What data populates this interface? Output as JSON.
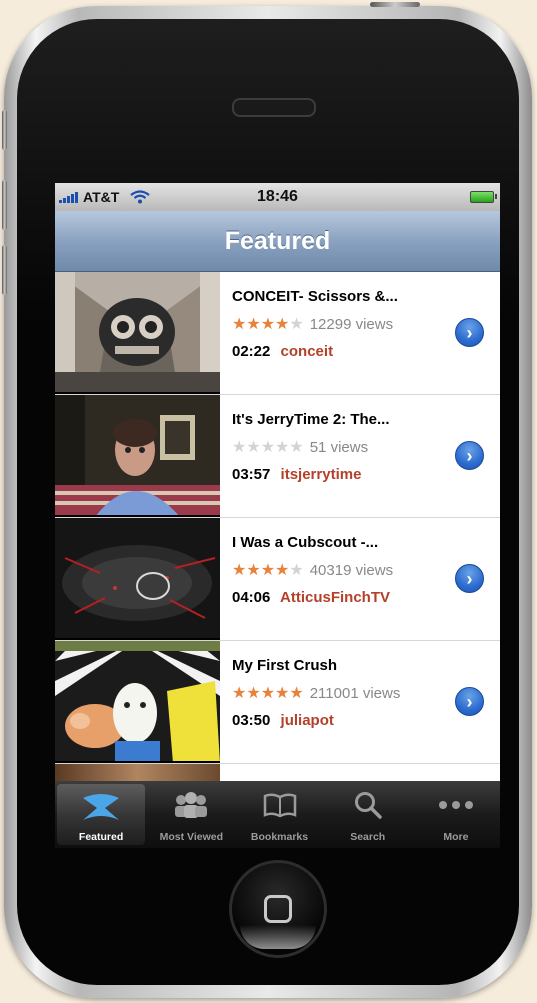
{
  "status_bar": {
    "carrier": "AT&T",
    "time": "18:46"
  },
  "nav": {
    "title": "Featured"
  },
  "videos": [
    {
      "title": "CONCEIT- Scissors &...",
      "rating": 4,
      "views": "12299 views",
      "duration": "02:22",
      "author": "conceit"
    },
    {
      "title": "It's JerryTime 2: The...",
      "rating": 0,
      "views": "51 views",
      "duration": "03:57",
      "author": "itsjerrytime"
    },
    {
      "title": "I Was a Cubscout -...",
      "rating": 4,
      "views": "40319 views",
      "duration": "04:06",
      "author": "AtticusFinchTV"
    },
    {
      "title": "My First Crush",
      "rating": 5,
      "views": "211001 views",
      "duration": "03:50",
      "author": "juliapot"
    }
  ],
  "tabs": [
    {
      "label": "Featured",
      "icon": "star-icon",
      "active": true
    },
    {
      "label": "Most Viewed",
      "icon": "people-icon",
      "active": false
    },
    {
      "label": "Bookmarks",
      "icon": "book-icon",
      "active": false
    },
    {
      "label": "Search",
      "icon": "search-icon",
      "active": false
    },
    {
      "label": "More",
      "icon": "more-dots-icon",
      "active": false
    }
  ],
  "colors": {
    "star_on": "#e8813a",
    "author": "#b4402a",
    "nav_bar": "#8aa2c0",
    "disclosure": "#2c6ccf"
  }
}
